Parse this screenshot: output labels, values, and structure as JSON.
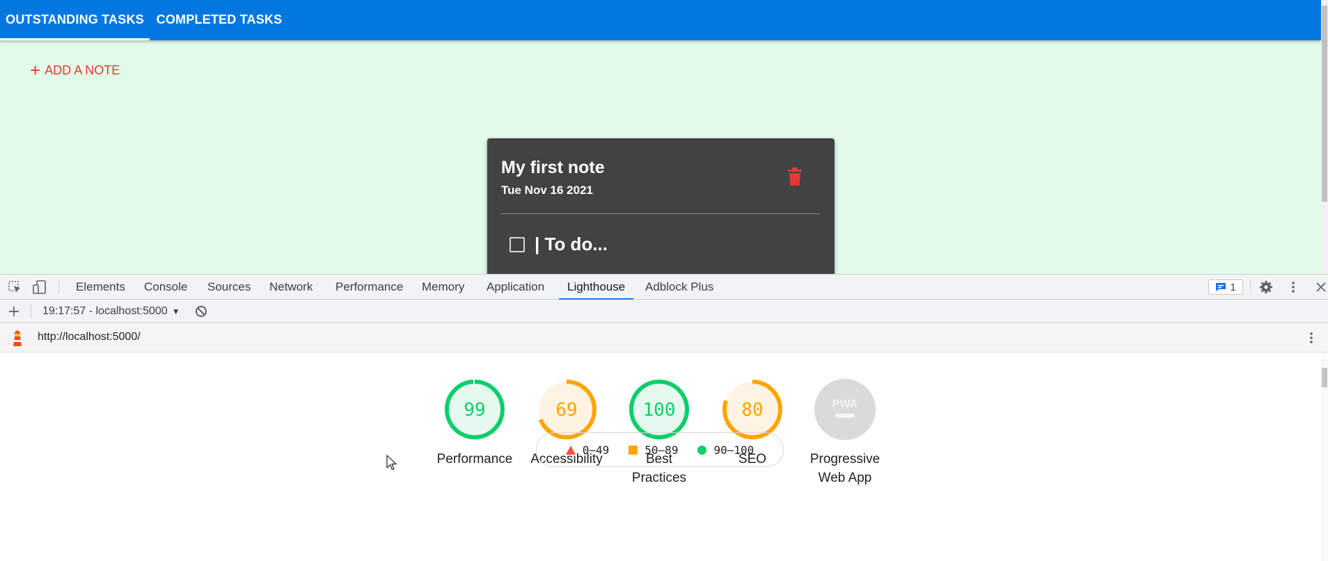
{
  "app": {
    "tabs": [
      {
        "label": "OUTSTANDING TASKS",
        "active": true
      },
      {
        "label": "COMPLETED TASKS",
        "active": false
      }
    ],
    "add_note": {
      "icon": "plus-icon",
      "label": "ADD A NOTE"
    },
    "note": {
      "title": "My first note",
      "date": "Tue Nov 16 2021",
      "delete_icon": "trash-icon",
      "items": [
        {
          "text": "| To do...",
          "checked": false
        }
      ]
    },
    "colors": {
      "appbar": "#0078e0",
      "background": "#e1fbe8",
      "accent": "#e53935",
      "card": "#424242"
    }
  },
  "devtools": {
    "tabs": [
      {
        "label": "Elements"
      },
      {
        "label": "Console"
      },
      {
        "label": "Sources"
      },
      {
        "label": "Network"
      },
      {
        "label": "Performance"
      },
      {
        "label": "Memory"
      },
      {
        "label": "Application"
      },
      {
        "label": "Lighthouse",
        "active": true
      },
      {
        "label": "Adblock Plus"
      }
    ],
    "issues_count": "1",
    "toolbar": {
      "new_report_icon": "plus-icon",
      "report_select": "19:17:57 - localhost:5000",
      "clear_icon": "block-icon"
    },
    "url_bar": {
      "url": "http://localhost:5000/",
      "icon": "lighthouse-icon",
      "menu_icon": "kebab-menu-icon"
    },
    "scores": [
      {
        "score": "99",
        "label": "Performance",
        "value": 99,
        "rating": "pass"
      },
      {
        "score": "69",
        "label": "Accessibility",
        "value": 69,
        "rating": "average"
      },
      {
        "score": "100",
        "label": "Best Practices",
        "value": 100,
        "rating": "pass"
      },
      {
        "score": "80",
        "label": "SEO",
        "value": 80,
        "rating": "average"
      },
      {
        "score": "",
        "label": "Progressive Web App",
        "value": null,
        "rating": "na",
        "badge": "PWA"
      }
    ],
    "legend": [
      {
        "shape": "triangle",
        "range": "0–49",
        "color": "#ff4e42"
      },
      {
        "shape": "square",
        "range": "50–89",
        "color": "#ffa400"
      },
      {
        "shape": "circle",
        "range": "90–100",
        "color": "#0cce6b"
      }
    ]
  }
}
